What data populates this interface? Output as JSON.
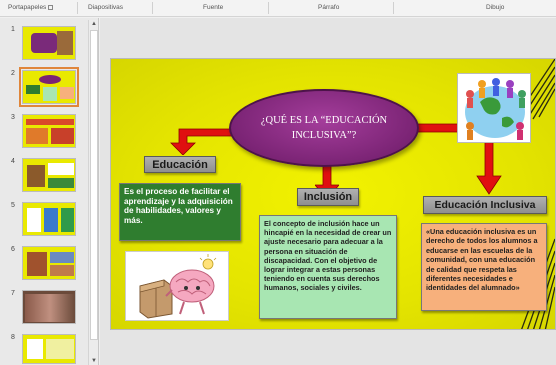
{
  "ribbon": {
    "groups": [
      "Portapapeles",
      "Diapositivas",
      "Fuente",
      "Párrafo",
      "Dibujo"
    ]
  },
  "thumbnails": {
    "items": [
      {
        "number": "1",
        "selected": false
      },
      {
        "number": "2",
        "selected": true
      },
      {
        "number": "3",
        "selected": false
      },
      {
        "number": "4",
        "selected": false
      },
      {
        "number": "5",
        "selected": false
      },
      {
        "number": "6",
        "selected": false
      },
      {
        "number": "7",
        "selected": false
      },
      {
        "number": "8",
        "selected": false
      }
    ]
  },
  "slide": {
    "title": "¿QUÉ ES LA “EDUCACIÓN INCLUSIVA”?",
    "education_label": "Educación",
    "education_text": "Es el proceso de facilitar el aprendizaje y la adquisición de habilidades, valores y más.",
    "inclusion_label": "Inclusión",
    "inclusion_text": "El concepto de inclusión hace un hincapié en la necesidad de crear un ajuste necesario para adecuar a la persona en situación de discapacidad. Con el objetivo de lograr integrar a estas personas teniendo en cuenta sus derechos humanos, sociales y civiles.",
    "inclusive_label": "Educación Inclusiva",
    "inclusive_text": "«Una educación inclusiva es un derecho de todos los alumnos a educarse en las escuelas de la comunidad, con una educación de calidad que respeta las diferentes necesidades e identidades del alumnado»"
  },
  "colors": {
    "slide_background": "#e8e800",
    "title_oval": "#7b2475",
    "arrow": "#e01010",
    "green_box": "#2f7d2f",
    "mint_box": "#a8e6b2",
    "orange_box": "#f7b07c",
    "selection": "#e0863a"
  }
}
